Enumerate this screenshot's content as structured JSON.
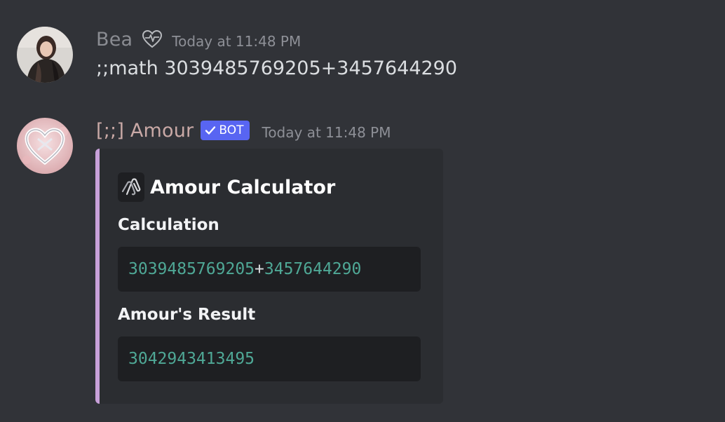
{
  "messages": [
    {
      "author": "Bea",
      "author_icon": "heartbeat-heart-icon",
      "timestamp": "Today at 11:48 PM",
      "content": ";;math 3039485769205+3457644290"
    },
    {
      "author": "[;;] Amour",
      "badge": "BOT",
      "badge_icon": "verified-check-icon",
      "timestamp": "Today at 11:48 PM",
      "embed": {
        "accent_color": "#c7a0d9",
        "title_icon": "paperclip-link-icon",
        "title": "Amour Calculator",
        "fields": [
          {
            "name": "Calculation",
            "value_parts": [
              "3039485769205",
              "+",
              "3457644290"
            ]
          },
          {
            "name": "Amour's Result",
            "value": "3042943413495"
          }
        ]
      }
    }
  ],
  "colors": {
    "background": "#313338",
    "embed_background": "#2b2d31",
    "code_background": "#1e1f22",
    "number_color": "#4fa896",
    "bot_badge": "#5865f2"
  }
}
